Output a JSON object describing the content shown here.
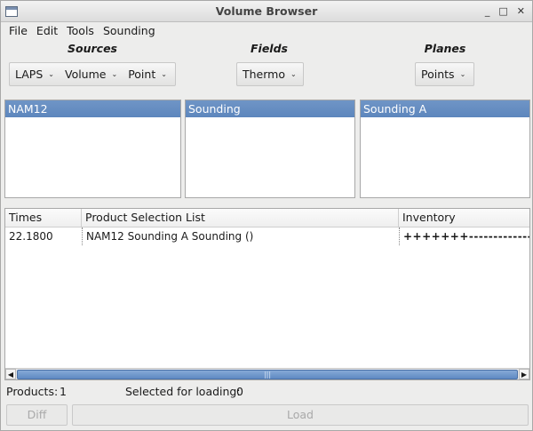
{
  "window": {
    "title": "Volume Browser",
    "controls": {
      "minimize": "_",
      "maximize": "□",
      "close": "✕"
    }
  },
  "menu": [
    "File",
    "Edit",
    "Tools",
    "Sounding"
  ],
  "sections": {
    "sources": "Sources",
    "fields": "Fields",
    "planes": "Planes"
  },
  "sources_buttons": {
    "laps": "LAPS",
    "volume": "Volume",
    "point": "Point"
  },
  "fields_button": "Thermo",
  "planes_button": "Points",
  "lists": {
    "sources_selected": "NAM12",
    "fields_selected": "Sounding",
    "planes_selected": "Sounding A"
  },
  "table": {
    "headers": {
      "times": "Times",
      "product": "Product Selection List",
      "inventory": "Inventory"
    },
    "rows": [
      {
        "time": "22.1800",
        "product": "NAM12 Sounding A Sounding ()",
        "inventory": "+++++++-------------------"
      }
    ]
  },
  "scrollbar": {
    "left": "◀",
    "right": "▶",
    "grip": "|||"
  },
  "status": {
    "products_label": "Products:",
    "products_count": "1",
    "selected_label": "Selected for loading:",
    "selected_count": "0"
  },
  "buttons": {
    "diff": "Diff",
    "load": "Load"
  }
}
